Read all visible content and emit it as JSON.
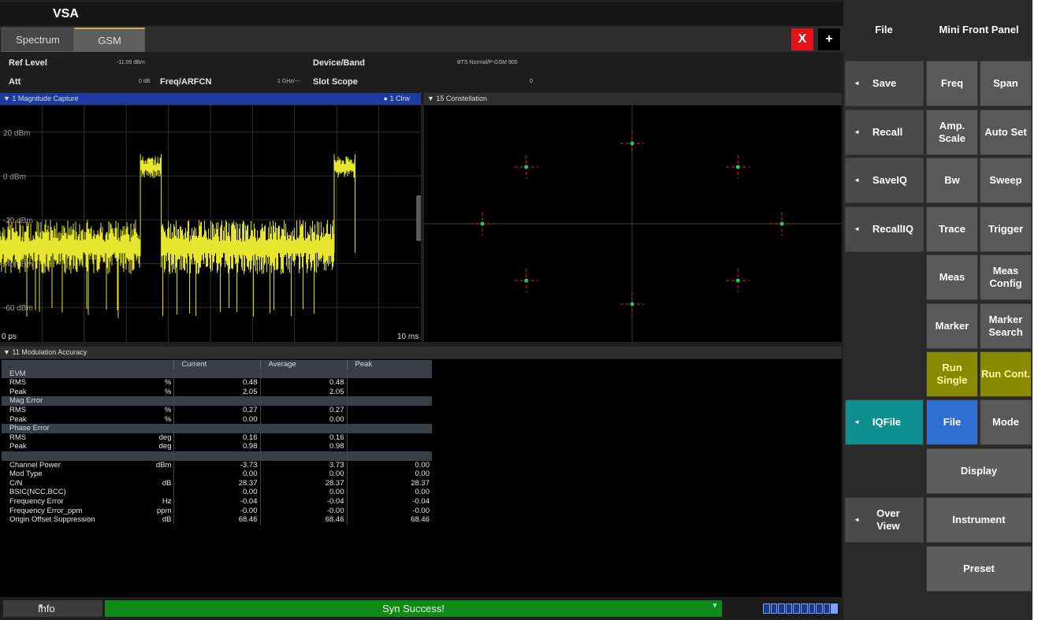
{
  "app": {
    "title": "VSA"
  },
  "tabs": [
    {
      "label": "Spectrum",
      "active": false
    },
    {
      "label": "GSM",
      "active": true
    }
  ],
  "toolbar": {
    "close_label": "X",
    "add_label": "+"
  },
  "settings": {
    "ref_level_label": "Ref Level",
    "ref_level_value": "-11.09 dBm",
    "att_label": "Att",
    "att_value": "0 dB",
    "freq_label": "Freq/ARFCN",
    "freq_value": "1 GHz/---",
    "device_label": "Device/Band",
    "device_value": "BTS Normal/P-GSM 900",
    "slot_label": "Slot Scope",
    "slot_value": "0"
  },
  "windows": {
    "magnitude": {
      "title": "▼ 1 Magnitude Capture",
      "badge": "● 1 Clrw",
      "y_ticks": [
        "20 dBm",
        "0 dBm",
        "-20 dBm",
        "-40 dBm",
        "-60 dBm"
      ],
      "x_start": "0 ps",
      "x_end": "10 ms"
    },
    "constellation": {
      "title": "▼ 15 Constellation"
    },
    "modulation": {
      "title": "▼ 11 Modulation Accuracy"
    }
  },
  "chart_data": [
    {
      "type": "line",
      "title": "1 Magnitude Capture",
      "xlabel": "",
      "ylabel": "",
      "x_range": [
        "0 ps",
        "10 ms"
      ],
      "ylim": [
        -70,
        30
      ],
      "y_ticks": [
        20,
        0,
        -20,
        -40,
        -60
      ],
      "grid": true,
      "series": [
        {
          "name": "1 Clrw",
          "color": "#e6e62e",
          "segments": [
            {
              "x_from": 0.0,
              "x_to": 3.36,
              "level": -30,
              "noise": 10,
              "dips_to": -65
            },
            {
              "x_from": 3.36,
              "x_to": 3.86,
              "level": 5,
              "noise": 4
            },
            {
              "x_from": 3.86,
              "x_to": 8.0,
              "level": -30,
              "noise": 10,
              "dips_to": -65
            },
            {
              "x_from": 8.0,
              "x_to": 8.5,
              "level": 5,
              "noise": 4
            },
            {
              "x_from": 8.5,
              "x_to": 10.0,
              "level": -68,
              "noise": 0
            }
          ]
        }
      ]
    },
    {
      "type": "scatter",
      "title": "15 Constellation",
      "xlim": [
        -1.3,
        1.3
      ],
      "ylim": [
        -1.3,
        1.3
      ],
      "points": [
        {
          "x": 0,
          "y": 1
        },
        {
          "x": 0.707,
          "y": 0.707
        },
        {
          "x": 1,
          "y": 0
        },
        {
          "x": 0.707,
          "y": -0.707
        },
        {
          "x": 0,
          "y": -1
        },
        {
          "x": -0.707,
          "y": -0.707
        },
        {
          "x": -1,
          "y": 0
        },
        {
          "x": -0.707,
          "y": 0.707
        }
      ],
      "point_color": "#1fd14a",
      "cross_color": "#a01818"
    }
  ],
  "mod_table": {
    "headers": [
      "",
      "",
      "Current",
      "Average",
      "Peak"
    ],
    "rows": [
      {
        "group": "EVM"
      },
      {
        "name": "RMS",
        "unit": "%",
        "current": "0.48",
        "average": "0.48",
        "peak": ""
      },
      {
        "name": "Peak",
        "unit": "%",
        "current": "2.05",
        "average": "2.05",
        "peak": ""
      },
      {
        "group": "Mag Error"
      },
      {
        "name": "RMS",
        "unit": "%",
        "current": "0.27",
        "average": "0.27",
        "peak": ""
      },
      {
        "name": "Peak",
        "unit": "%",
        "current": "0.00",
        "average": "0.00",
        "peak": ""
      },
      {
        "group": "Phase Error"
      },
      {
        "name": "RMS",
        "unit": "deg",
        "current": "0.16",
        "average": "0.16",
        "peak": ""
      },
      {
        "name": "Peak",
        "unit": "deg",
        "current": "0.98",
        "average": "0.98",
        "peak": ""
      },
      {
        "group": ""
      },
      {
        "name": "Channel Power",
        "unit": "dBm",
        "current": "-3.73",
        "average": "3.73",
        "peak": "0.00"
      },
      {
        "name": "Mod Type",
        "unit": "",
        "current": "0.00",
        "average": "0.00",
        "peak": "0.00"
      },
      {
        "name": "C/N",
        "unit": "dB",
        "current": "28.37",
        "average": "28.37",
        "peak": "28.37"
      },
      {
        "name": "BSIC(NCC,BCC)",
        "unit": "",
        "current": "0.00",
        "average": "0.00",
        "peak": "0.00"
      },
      {
        "name": "Frequency Error",
        "unit": "Hz",
        "current": "-0.04",
        "average": "-0.04",
        "peak": "-0.04"
      },
      {
        "name": "Frequency Error_ppm",
        "unit": "ppm",
        "current": "-0.00",
        "average": "-0.00",
        "peak": "-0.00"
      },
      {
        "name": "Origin Offset Suppression",
        "unit": "dB",
        "current": "68.46",
        "average": "68.46",
        "peak": "68.46"
      }
    ]
  },
  "status": {
    "info_label": "Info",
    "message": "Syn Success!"
  },
  "softkeys": {
    "file_header": "File",
    "mini_front_panel": "Mini Front Panel",
    "save": "Save",
    "recall": "Recall",
    "saveiq": "SaveIQ",
    "recalliq": "RecallIQ",
    "iqfile": "IQFile",
    "overview": "Over View",
    "freq": "Freq",
    "span": "Span",
    "amp_scale": "Amp. Scale",
    "auto_set": "Auto Set",
    "bw": "Bw",
    "sweep": "Sweep",
    "trace": "Trace",
    "trigger": "Trigger",
    "meas": "Meas",
    "meas_config": "Meas Config",
    "marker": "Marker",
    "marker_search": "Marker Search",
    "run_single": "Run Single",
    "run_cont": "Run Cont.",
    "file": "File",
    "mode": "Mode",
    "display": "Display",
    "instrument": "Instrument",
    "preset": "Preset"
  }
}
